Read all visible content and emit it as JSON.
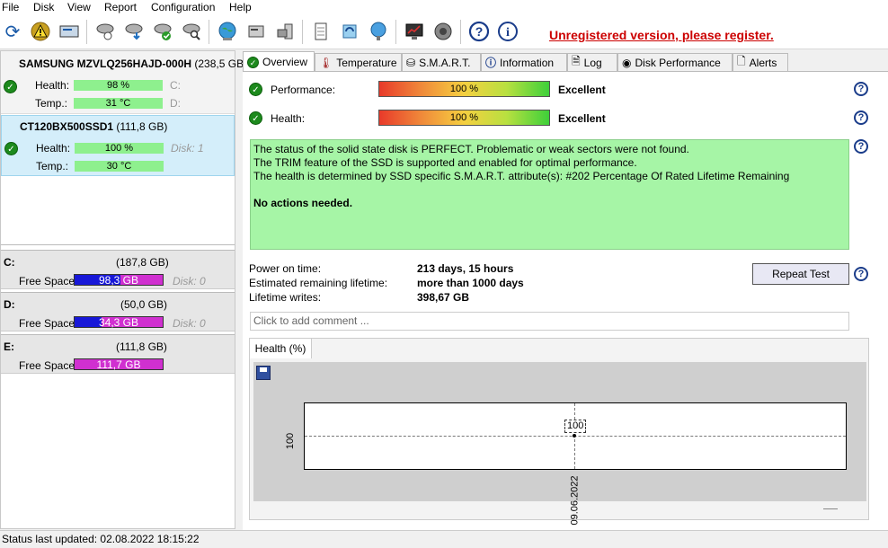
{
  "menu": {
    "items": [
      {
        "label": "File"
      },
      {
        "label": "Disk"
      },
      {
        "label": "View"
      },
      {
        "label": "Report"
      },
      {
        "label": "Configuration"
      },
      {
        "label": "Help"
      }
    ]
  },
  "toolbar": {
    "register_text": "Unregistered version, please register.",
    "icons": [
      "refresh-icon",
      "warning-icon",
      "drive-icon",
      "disk-scan-icon",
      "disk-download-icon",
      "disk-check-icon",
      "disk-search-icon",
      "globe-icon",
      "server-icon",
      "computer-icon",
      "document-icon",
      "sync-icon",
      "network-globe-icon",
      "monitor-chart-icon",
      "speaker-icon",
      "help-icon",
      "info-icon"
    ]
  },
  "disks": [
    {
      "name": "SAMSUNG MZVLQ256HAJD-000H",
      "size": "(238,5 GB)",
      "health_label": "Health:",
      "health_value": "98 %",
      "temp_label": "Temp.:",
      "temp_value": "31 °C",
      "drive1": "C:",
      "drive2": "D:"
    },
    {
      "name": "CT120BX500SSD1",
      "size": "(111,8 GB)",
      "health_label": "Health:",
      "health_value": "100 %",
      "temp_label": "Temp.:",
      "temp_value": "30 °C",
      "drive1": "Disk: 1"
    }
  ],
  "volumes": [
    {
      "letter": "C:",
      "size": "(187,8 GB)",
      "free_label": "Free Space",
      "free_value": "98,3 GB",
      "fill_pct": 52,
      "disk": "Disk: 0"
    },
    {
      "letter": "D:",
      "size": "(50,0 GB)",
      "free_label": "Free Space",
      "free_value": "34,3 GB",
      "fill_pct": 31,
      "disk": "Disk: 0"
    },
    {
      "letter": "E:",
      "size": "(111,8 GB)",
      "free_label": "Free Space",
      "free_value": "111,7 GB",
      "fill_pct": 0,
      "disk": ""
    }
  ],
  "tabs": [
    {
      "label": "Overview"
    },
    {
      "label": "Temperature"
    },
    {
      "label": "S.M.A.R.T."
    },
    {
      "label": "Information"
    },
    {
      "label": "Log"
    },
    {
      "label": "Disk Performance"
    },
    {
      "label": "Alerts"
    }
  ],
  "overview": {
    "performance_label": "Performance:",
    "performance_value": "100 %",
    "performance_rating": "Excellent",
    "health_label": "Health:",
    "health_value": "100 %",
    "health_rating": "Excellent",
    "status_lines": [
      "The status of the solid state disk is PERFECT. Problematic or weak sectors were not found.",
      "The TRIM feature of the SSD is supported and enabled for optimal performance.",
      "The health is determined by SSD specific S.M.A.R.T. attribute(s):  #202 Percentage Of Rated Lifetime Remaining"
    ],
    "status_action": "No actions needed.",
    "power_on_label": "Power on time:",
    "power_on_value": "213 days, 15 hours",
    "remaining_label": "Estimated remaining lifetime:",
    "remaining_value": "more than 1000 days",
    "writes_label": "Lifetime writes:",
    "writes_value": "398,67 GB",
    "repeat_button": "Repeat Test",
    "comment_placeholder": "Click to add comment ...",
    "help_glyph": "?"
  },
  "chart_data": {
    "type": "line",
    "tab_label": "Health (%)",
    "x": [
      "09.06.2022"
    ],
    "series": [
      {
        "values": [
          100
        ]
      }
    ],
    "ytick": "100",
    "point_label": "100"
  },
  "statusbar": {
    "text": "Status last updated: 02.08.2022 18:15:22"
  }
}
